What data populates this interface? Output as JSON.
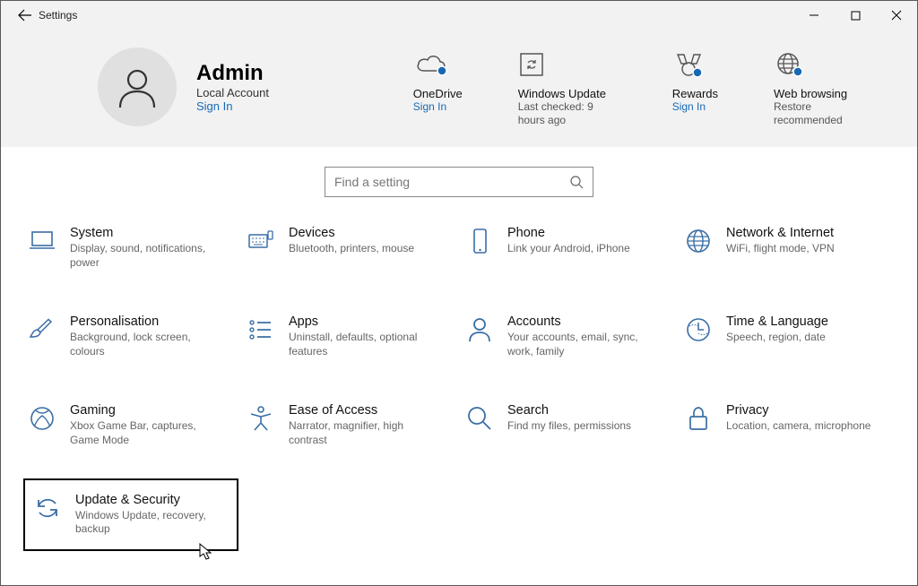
{
  "window": {
    "title": "Settings"
  },
  "user": {
    "name": "Admin",
    "subtitle": "Local Account",
    "link": "Sign In"
  },
  "tiles": [
    {
      "title": "OneDrive",
      "sub": "Sign In",
      "key": "onedrive"
    },
    {
      "title": "Windows Update",
      "sub": "Last checked: 9 hours ago",
      "key": "update"
    },
    {
      "title": "Rewards",
      "sub": "Sign In",
      "key": "rewards"
    },
    {
      "title": "Web browsing",
      "sub": "Restore recommended",
      "key": "web"
    }
  ],
  "search": {
    "placeholder": "Find a setting"
  },
  "categories": [
    {
      "title": "System",
      "sub": "Display, sound, notifications, power"
    },
    {
      "title": "Devices",
      "sub": "Bluetooth, printers, mouse"
    },
    {
      "title": "Phone",
      "sub": "Link your Android, iPhone"
    },
    {
      "title": "Network & Internet",
      "sub": "WiFi, flight mode, VPN"
    },
    {
      "title": "Personalisation",
      "sub": "Background, lock screen, colours"
    },
    {
      "title": "Apps",
      "sub": "Uninstall, defaults, optional features"
    },
    {
      "title": "Accounts",
      "sub": "Your accounts, email, sync, work, family"
    },
    {
      "title": "Time & Language",
      "sub": "Speech, region, date"
    },
    {
      "title": "Gaming",
      "sub": "Xbox Game Bar, captures, Game Mode"
    },
    {
      "title": "Ease of Access",
      "sub": "Narrator, magnifier, high contrast"
    },
    {
      "title": "Search",
      "sub": "Find my files, permissions"
    },
    {
      "title": "Privacy",
      "sub": "Location, camera, microphone"
    },
    {
      "title": "Update & Security",
      "sub": "Windows Update, recovery, backup"
    }
  ]
}
